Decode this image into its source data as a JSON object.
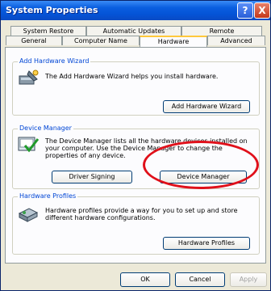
{
  "window": {
    "title": "System Properties",
    "help_label": "?",
    "close_label": "X"
  },
  "tabs": {
    "row1": [
      "System Restore",
      "Automatic Updates",
      "Remote"
    ],
    "row2": [
      "General",
      "Computer Name",
      "Hardware",
      "Advanced"
    ],
    "active": "Hardware"
  },
  "wizard": {
    "title": "Add Hardware Wizard",
    "description": "The Add Hardware Wizard helps you install hardware.",
    "button": "Add Hardware Wizard"
  },
  "device_manager": {
    "title": "Device Manager",
    "description": "The Device Manager lists all the hardware devices installed on your computer. Use the Device Manager to change the properties of any device.",
    "driver_signing_button": "Driver Signing",
    "device_manager_button": "Device Manager"
  },
  "hardware_profiles": {
    "title": "Hardware Profiles",
    "description": "Hardware profiles provide a way for you to set up and store different hardware configurations.",
    "button": "Hardware Profiles"
  },
  "footer": {
    "ok": "OK",
    "cancel": "Cancel",
    "apply": "Apply"
  },
  "colors": {
    "titlebar": "#0453d6",
    "group_label": "#0046d5",
    "highlight": "#e0101a"
  }
}
